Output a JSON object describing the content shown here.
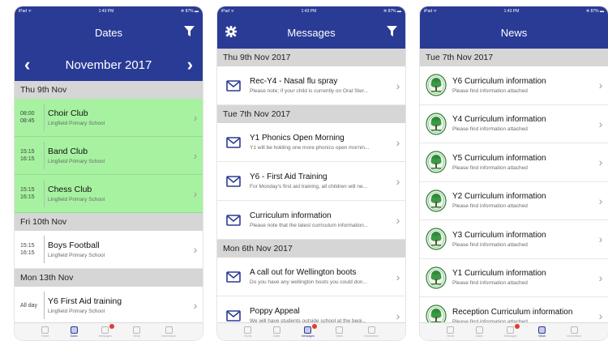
{
  "colors": {
    "header": "#2a3b96",
    "event_highlight": "#a6f2a0",
    "section": "#d6d6d6",
    "badge": "#e53b2c"
  },
  "status": {
    "left": "iPad ᯤ",
    "time": "1:43 PM",
    "right": "✲ 87% ▬"
  },
  "tabs": [
    "Home",
    "Dates",
    "Messages",
    "News",
    "Information"
  ],
  "dates": {
    "title": "Dates",
    "filter_icon": "filter-icon",
    "month": "November 2017",
    "prev": "‹",
    "next": "›",
    "sections": [
      {
        "label": "Thu 9th Nov",
        "events": [
          {
            "start": "08:00",
            "end": "08:45",
            "title": "Choir Club",
            "sub": "Lingfield Primary School",
            "highlight": true
          },
          {
            "start": "15:15",
            "end": "16:15",
            "title": "Band Club",
            "sub": "Lingfield Primary School",
            "highlight": true
          },
          {
            "start": "15:15",
            "end": "16:15",
            "title": "Chess Club",
            "sub": "Lingfield Primary School",
            "highlight": true
          }
        ]
      },
      {
        "label": "Fri 10th Nov",
        "events": [
          {
            "start": "15:15",
            "end": "16:15",
            "title": "Boys Football",
            "sub": "Lingfield Primary School",
            "highlight": false
          }
        ]
      },
      {
        "label": "Mon 13th Nov",
        "events": [
          {
            "start": "All day",
            "end": "",
            "title": "Y6 First Aid training",
            "sub": "Lingfield Primary School",
            "highlight": false
          }
        ]
      }
    ],
    "active_tab": 1
  },
  "messages": {
    "title": "Messages",
    "settings_icon": "gear-icon",
    "filter_icon": "filter-icon",
    "sections": [
      {
        "label": "Thu 9th Nov 2017",
        "items": [
          {
            "title": "Rec-Y4 - Nasal flu spray",
            "sub": "Please note; if your child is currently on Oral Ster..."
          }
        ]
      },
      {
        "label": "Tue 7th Nov 2017",
        "items": [
          {
            "title": "Y1 Phonics Open Morning",
            "sub": "Y1 will be holding one more phonics open mornin..."
          },
          {
            "title": "Y6 - First Aid Training",
            "sub": "For Monday's first aid training, all children will ne..."
          },
          {
            "title": "Curriculum information",
            "sub": "Please note that the latest curriculum information..."
          }
        ]
      },
      {
        "label": "Mon 6th Nov 2017",
        "items": [
          {
            "title": "A call out for Wellington boots",
            "sub": "Do you have any wellington boots you could don..."
          },
          {
            "title": "Poppy Appeal",
            "sub": "We will have students outside school at the begi..."
          }
        ]
      }
    ],
    "active_tab": 2
  },
  "news": {
    "title": "News",
    "sections": [
      {
        "label": "Tue 7th Nov 2017",
        "items": [
          {
            "title": "Y6 Curriculum information",
            "sub": "Please find information attached"
          },
          {
            "title": "Y4 Curriculum information",
            "sub": "Please find information attached"
          },
          {
            "title": "Y5 Curriculum information",
            "sub": "Please find information attached"
          },
          {
            "title": "Y2 Curriculum information",
            "sub": "Please find information attached"
          },
          {
            "title": "Y3 Curriculum information",
            "sub": "Please find information attached"
          },
          {
            "title": "Y1 Curriculum information",
            "sub": "Please find information attached"
          },
          {
            "title": "Reception Curriculum information",
            "sub": "Please find information attached"
          }
        ]
      }
    ],
    "active_tab": 3
  }
}
